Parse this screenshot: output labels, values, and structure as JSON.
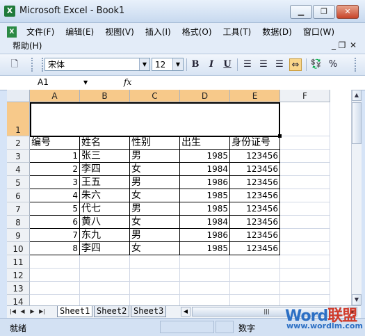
{
  "window": {
    "title": "Microsoft Excel - Book1",
    "minimize": "▁",
    "maximize": "❐",
    "close": "✕",
    "app_icon": "X"
  },
  "menu": {
    "items": [
      "文件(F)",
      "编辑(E)",
      "视图(V)",
      "插入(I)",
      "格式(O)",
      "工具(T)",
      "数据(D)",
      "窗口(W)"
    ],
    "help": "帮助(H)"
  },
  "toolbar": {
    "font_name": "宋体",
    "font_size": "12",
    "bold": "B",
    "italic": "I",
    "underline": "U",
    "percent": "%"
  },
  "formula_bar": {
    "name_box": "A1",
    "fx": "fx",
    "value": ""
  },
  "grid": {
    "columns": [
      "A",
      "B",
      "C",
      "D",
      "E",
      "F"
    ],
    "selected_columns": [
      "A",
      "B",
      "C",
      "D",
      "E"
    ],
    "rows": [
      "1",
      "2",
      "3",
      "4",
      "5",
      "6",
      "7",
      "8",
      "9",
      "10",
      "11",
      "12",
      "13",
      "14"
    ],
    "header": [
      "编号",
      "姓名",
      "性别",
      "出生",
      "身份证号"
    ],
    "data": [
      [
        1,
        "张三",
        "男",
        1985,
        123456
      ],
      [
        2,
        "李四",
        "女",
        1984,
        123456
      ],
      [
        3,
        "王五",
        "男",
        1986,
        123456
      ],
      [
        4,
        "朱六",
        "女",
        1985,
        123456
      ],
      [
        5,
        "代七",
        "男",
        1985,
        123456
      ],
      [
        6,
        "黄八",
        "女",
        1984,
        123456
      ],
      [
        7,
        "东九",
        "男",
        1986,
        123456
      ],
      [
        8,
        "李四",
        "女",
        1985,
        123456
      ]
    ]
  },
  "sheets": {
    "tabs": [
      "Sheet1",
      "Sheet2",
      "Sheet3"
    ],
    "active": "Sheet1"
  },
  "status": {
    "ready": "就绪",
    "num": "数字"
  },
  "watermark": {
    "brand_a": "Word",
    "brand_b": "联盟",
    "url": "www.wordlm.com"
  }
}
